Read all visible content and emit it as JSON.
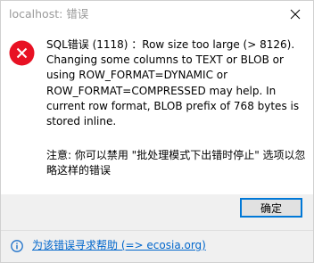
{
  "window": {
    "title": "localhost: 错误",
    "close_icon": "close-icon"
  },
  "message": {
    "icon": "error-icon",
    "icon_color": "#e81123",
    "text": "SQL错误 (1118) ：Row size too large (> 8126).\nChanging some columns to TEXT or BLOB or\nusing ROW_FORMAT=DYNAMIC or\nROW_FORMAT=COMPRESSED may help. In\ncurrent row format, BLOB prefix of 768 bytes is\nstored inline.",
    "note": "注意: 你可以禁用 \"批处理模式下出错时停止\" 选项以忽略这样的错误"
  },
  "buttons": {
    "ok_label": "确定",
    "accent_color": "#0078d7"
  },
  "footer": {
    "info_icon": "info-icon",
    "help_link": "为该错误寻求帮助 (=> ecosia.org)",
    "link_color": "#0066cc"
  }
}
